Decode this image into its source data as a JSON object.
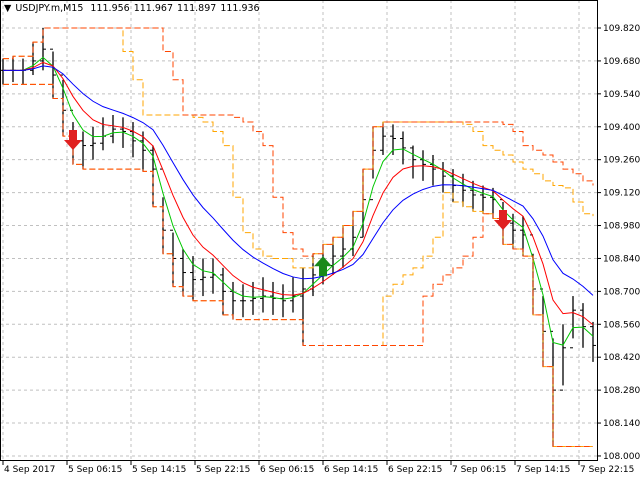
{
  "header": {
    "symbol": "USDJPY.m,M15",
    "open": "111.956",
    "high": "111.967",
    "low": "111.897",
    "close": "111.936"
  },
  "chart_data": {
    "type": "candlestick",
    "title": "USDJPY.m,M15",
    "ylim": [
      108.0,
      109.89
    ],
    "yticks": [
      "109.820",
      "109.680",
      "109.540",
      "109.400",
      "109.260",
      "109.120",
      "108.980",
      "108.840",
      "108.700",
      "108.560",
      "108.420",
      "108.280",
      "108.140",
      "108.000"
    ],
    "xticks": [
      "4 Sep 2017",
      "5 Sep 06:15",
      "5 Sep 14:15",
      "5 Sep 22:15",
      "6 Sep 06:15",
      "6 Sep 14:15",
      "6 Sep 22:15",
      "7 Sep 06:15",
      "7 Sep 14:15",
      "7 Sep 22:15"
    ],
    "grid": true,
    "close": [
      109.64,
      109.64,
      109.64,
      109.68,
      109.73,
      109.62,
      109.47,
      109.34,
      109.32,
      109.33,
      109.36,
      109.39,
      109.38,
      109.34,
      109.3,
      109.22,
      108.96,
      108.84,
      108.78,
      108.75,
      108.76,
      108.77,
      108.7,
      108.66,
      108.66,
      108.67,
      108.68,
      108.67,
      108.66,
      108.68,
      108.71,
      108.77,
      108.81,
      108.85,
      108.88,
      108.93,
      109.09,
      109.3,
      109.36,
      109.35,
      109.31,
      109.26,
      109.24,
      109.22,
      109.19,
      109.15,
      109.13,
      109.11,
      109.1,
      109.09,
      108.99,
      108.96,
      108.94,
      108.71,
      108.53,
      108.28,
      108.46,
      108.62,
      108.55,
      108.47
    ],
    "high": [
      109.69,
      109.7,
      109.69,
      109.76,
      109.82,
      109.72,
      109.6,
      109.42,
      109.38,
      109.4,
      109.44,
      109.45,
      109.44,
      109.42,
      109.38,
      109.32,
      109.1,
      108.95,
      108.88,
      108.85,
      108.84,
      108.84,
      108.8,
      108.74,
      108.73,
      108.74,
      108.76,
      108.74,
      108.73,
      108.76,
      108.8,
      108.86,
      108.9,
      108.93,
      108.98,
      109.04,
      109.22,
      109.4,
      109.42,
      109.41,
      109.38,
      109.32,
      109.3,
      109.28,
      109.25,
      109.22,
      109.2,
      109.17,
      109.15,
      109.14,
      109.08,
      109.03,
      109.02,
      108.86,
      108.68,
      108.5,
      108.56,
      108.68,
      108.65,
      108.57
    ],
    "low": [
      109.58,
      109.59,
      109.58,
      109.62,
      109.64,
      109.52,
      109.36,
      109.24,
      109.22,
      109.26,
      109.3,
      109.33,
      109.31,
      109.27,
      109.21,
      109.06,
      108.86,
      108.72,
      108.68,
      108.66,
      108.68,
      108.69,
      108.6,
      108.58,
      108.59,
      108.6,
      108.61,
      108.6,
      108.59,
      108.61,
      108.47,
      108.68,
      108.73,
      108.77,
      108.8,
      108.85,
      108.93,
      109.18,
      109.28,
      109.28,
      109.24,
      109.18,
      109.17,
      109.15,
      109.12,
      109.08,
      109.06,
      109.04,
      109.03,
      109.01,
      108.9,
      108.88,
      108.85,
      108.6,
      108.38,
      108.04,
      108.3,
      108.5,
      108.46,
      108.4
    ],
    "signals": [
      {
        "index": 7,
        "type": "sell"
      },
      {
        "index": 32,
        "type": "buy"
      },
      {
        "index": 50,
        "type": "sell"
      }
    ],
    "indicators": [
      {
        "name": "fast-ma",
        "period": 3,
        "color": "#00c800"
      },
      {
        "name": "mid-ma",
        "period": 6,
        "color": "#ff0000"
      },
      {
        "name": "slow-ma",
        "period": 12,
        "color": "#0000ff"
      },
      {
        "name": "channel-inner",
        "period": 8,
        "color": "#ffa500"
      },
      {
        "name": "channel-outer",
        "period": 12,
        "color": "#ff4500"
      }
    ],
    "colors": {
      "sell": "#e02020",
      "buy": "#1a8a1a",
      "bars": "#000000",
      "grid": "#c0c0c0"
    }
  }
}
